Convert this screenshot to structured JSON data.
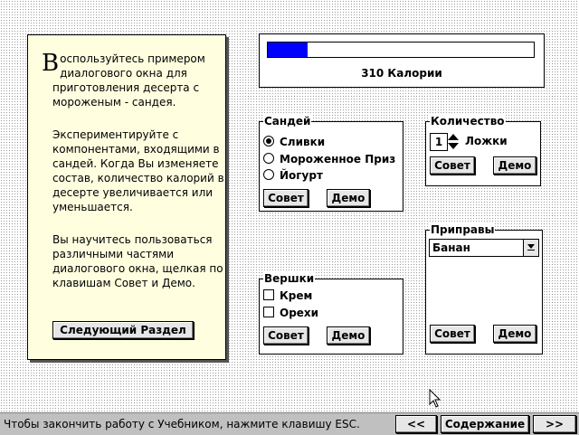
{
  "info_panel": {
    "dropcap": "В",
    "para1_rest": "оспользуйтесь примером диалогового окна для приготовления десерта с мороженым - сандея.",
    "para2": "Экспериментируйте с компонентами, входящими в сандей. Когда Вы изменяете состав, количество калорий в десерте увеличивается или уменьшается.",
    "para3": "Вы научитесь пользоваться различными частями диалогового окна, щелкая по клавишам Совет и Демо.",
    "next_button": "Следующий Раздел"
  },
  "calories": {
    "label": "310 Калории",
    "progress": 0.15,
    "bar_color": "#0000ff"
  },
  "sundae": {
    "title": "Сандей",
    "options": [
      "Сливки",
      "Мороженное Приз",
      "Йогурт"
    ],
    "selected": 0,
    "tip_button": "Совет",
    "demo_button": "Демо"
  },
  "quantity": {
    "title": "Количество",
    "value": "1",
    "unit": "Ложки",
    "tip_button": "Совет",
    "demo_button": "Демо"
  },
  "toppings": {
    "title": "Вершки",
    "options": [
      "Крем",
      "Орехи"
    ],
    "tip_button": "Совет",
    "demo_button": "Демо"
  },
  "condiments": {
    "title": "Приправы",
    "selected": "Банан",
    "tip_button": "Совет",
    "demo_button": "Демо"
  },
  "statusbar": {
    "message": "Чтобы закончить работу с Учебником, нажмите клавишу ESC.",
    "prev_button": "<<",
    "contents_button": "Содержание",
    "next_button": ">>"
  }
}
